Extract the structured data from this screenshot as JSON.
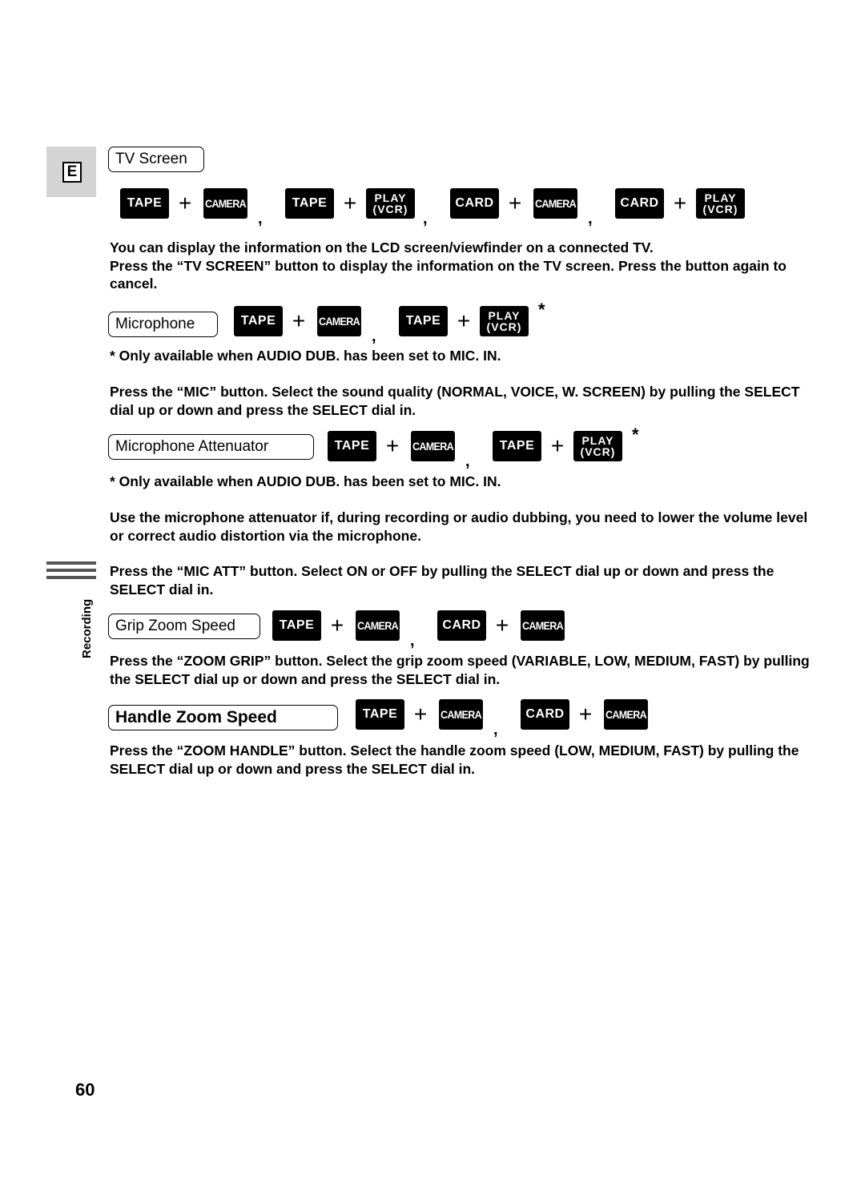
{
  "language_tab": {
    "letter": "E"
  },
  "side_tab": {
    "label": "Recording"
  },
  "page_number": "60",
  "sections": [
    {
      "title": "TV Screen",
      "modes": [
        {
          "keys": [
            "TAPE",
            "CAMERA"
          ]
        },
        {
          "keys": [
            "TAPE",
            "PLAY (VCR)"
          ]
        },
        {
          "keys": [
            "CARD",
            "CAMERA"
          ]
        },
        {
          "keys": [
            "CARD",
            "PLAY (VCR)"
          ]
        }
      ],
      "paragraphs": [
        "You can display the information on the LCD screen/viewfinder on a connected TV.\nPress the “TV SCREEN” button to display the information on the TV screen. Press the button again to cancel."
      ]
    },
    {
      "title": "Microphone",
      "modes": [
        {
          "keys": [
            "TAPE",
            "CAMERA"
          ]
        },
        {
          "keys": [
            "TAPE",
            "PLAY (VCR)"
          ]
        }
      ],
      "asterisk": "*",
      "note": "*  Only available when AUDIO DUB. has been set to MIC. IN.",
      "paragraphs": [
        "Press the “MIC” button. Select the sound quality (NORMAL, VOICE, W. SCREEN) by pulling the SELECT dial up or down and press the SELECT dial in."
      ]
    },
    {
      "title": "Microphone Attenuator",
      "modes": [
        {
          "keys": [
            "TAPE",
            "CAMERA"
          ]
        },
        {
          "keys": [
            "TAPE",
            "PLAY (VCR)"
          ]
        }
      ],
      "asterisk": "*",
      "note": "*  Only available when AUDIO DUB. has been set to MIC. IN.",
      "paragraphs": [
        "Use the microphone attenuator if, during recording or audio dubbing, you need to lower the volume level or correct audio distortion via the microphone.",
        "Press the “MIC ATT” button. Select ON or OFF by pulling the SELECT dial up or down and press the SELECT dial in."
      ]
    },
    {
      "title": "Grip Zoom Speed",
      "modes": [
        {
          "keys": [
            "TAPE",
            "CAMERA"
          ]
        },
        {
          "keys": [
            "CARD",
            "CAMERA"
          ]
        }
      ],
      "paragraphs": [
        "Press the “ZOOM GRIP” button. Select the grip zoom speed (VARIABLE, LOW, MEDIUM, FAST) by pulling the SELECT dial up or down and press the SELECT dial in."
      ]
    },
    {
      "title": "Handle Zoom Speed",
      "modes": [
        {
          "keys": [
            "TAPE",
            "CAMERA"
          ]
        },
        {
          "keys": [
            "CARD",
            "CAMERA"
          ]
        }
      ],
      "paragraphs": [
        "Press the “ZOOM HANDLE” button. Select the handle zoom speed (LOW, MEDIUM, FAST) by pulling the SELECT dial up or down and press the SELECT dial in."
      ]
    }
  ]
}
